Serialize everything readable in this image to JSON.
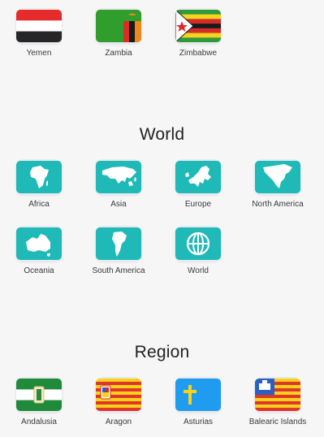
{
  "flags_row": [
    {
      "label": "Yemen",
      "icon": "yemen-flag-icon"
    },
    {
      "label": "Zambia",
      "icon": "zambia-flag-icon"
    },
    {
      "label": "Zimbabwe",
      "icon": "zimbabwe-flag-icon"
    }
  ],
  "world": {
    "title": "World",
    "items": [
      {
        "label": "Africa",
        "icon": "africa-map-icon"
      },
      {
        "label": "Asia",
        "icon": "asia-map-icon"
      },
      {
        "label": "Europe",
        "icon": "europe-map-icon"
      },
      {
        "label": "North America",
        "icon": "north-america-map-icon"
      },
      {
        "label": "Oceania",
        "icon": "oceania-map-icon"
      },
      {
        "label": "South America",
        "icon": "south-america-map-icon"
      },
      {
        "label": "World",
        "icon": "globe-icon"
      }
    ]
  },
  "region": {
    "title": "Region",
    "items": [
      {
        "label": "Andalusia",
        "icon": "andalusia-flag-icon"
      },
      {
        "label": "Aragon",
        "icon": "aragon-flag-icon"
      },
      {
        "label": "Asturias",
        "icon": "asturias-flag-icon"
      },
      {
        "label": "Balearic Islands",
        "icon": "balearic-islands-flag-icon"
      }
    ]
  },
  "colors": {
    "teal": "#1fb9b8",
    "background": "#f6f6f7"
  }
}
